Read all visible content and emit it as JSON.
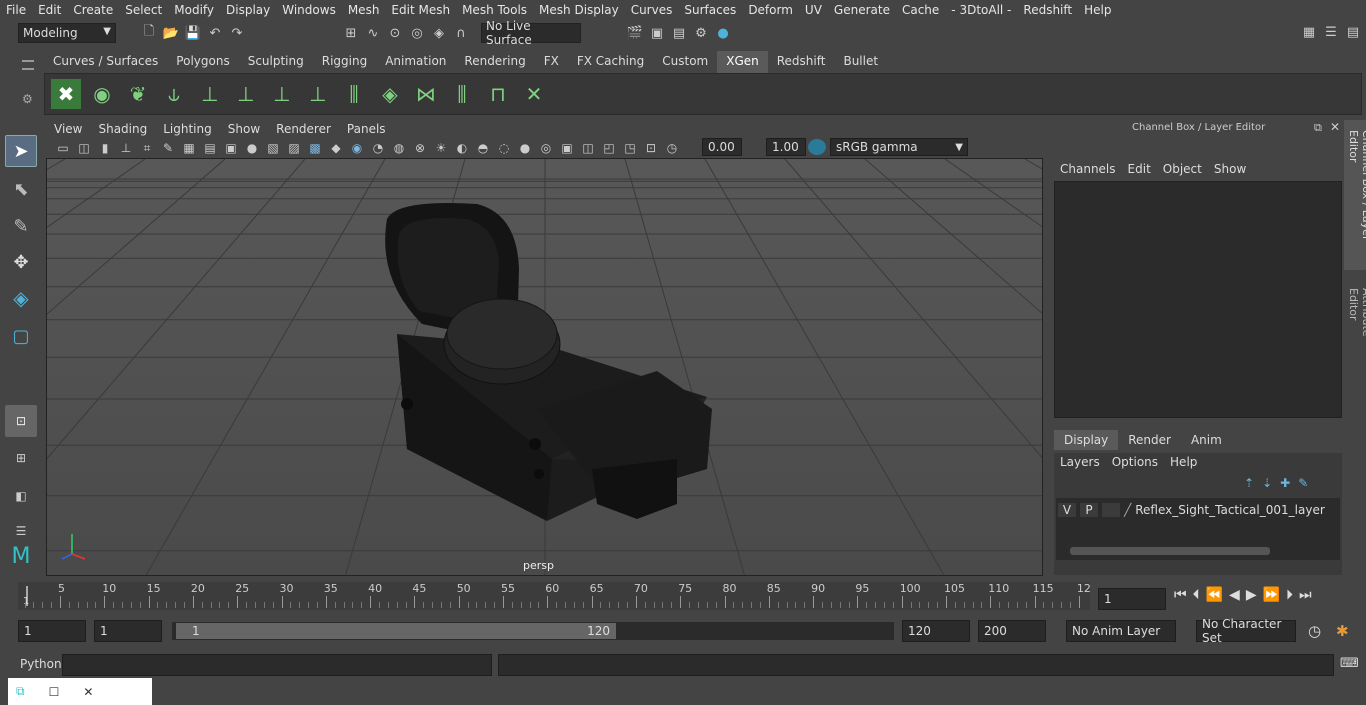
{
  "menubar": {
    "items": [
      "File",
      "Edit",
      "Create",
      "Select",
      "Modify",
      "Display",
      "Windows",
      "Mesh",
      "Edit Mesh",
      "Mesh Tools",
      "Mesh Display",
      "Curves",
      "Surfaces",
      "Deform",
      "UV",
      "Generate",
      "Cache",
      "- 3DtoAll -",
      "Redshift",
      "Help"
    ]
  },
  "status": {
    "mode": "Modeling",
    "live_surface": "No Live Surface"
  },
  "shelf": {
    "tabs": [
      "Curves / Surfaces",
      "Polygons",
      "Sculpting",
      "Rigging",
      "Animation",
      "Rendering",
      "FX",
      "FX Caching",
      "Custom",
      "XGen",
      "Redshift",
      "Bullet"
    ],
    "active_tab": "XGen"
  },
  "viewport": {
    "menu": [
      "View",
      "Shading",
      "Lighting",
      "Show",
      "Renderer",
      "Panels"
    ],
    "exposure": "0.00",
    "gamma": "1.00",
    "color_space": "sRGB gamma",
    "camera_label": "persp"
  },
  "channel_box": {
    "title": "Channel Box / Layer Editor",
    "menu": [
      "Channels",
      "Edit",
      "Object",
      "Show"
    ],
    "side_tabs": [
      "Channel Box / Layer Editor",
      "Attribute Editor"
    ],
    "layer_tabs": [
      "Display",
      "Render",
      "Anim"
    ],
    "active_layer_tab": "Display",
    "layer_menu": [
      "Layers",
      "Options",
      "Help"
    ],
    "layer": {
      "v": "V",
      "p": "P",
      "name": "Reflex_Sight_Tactical_001_layer"
    }
  },
  "timeline": {
    "ticks": [
      "5",
      "10",
      "15",
      "20",
      "25",
      "30",
      "35",
      "40",
      "45",
      "50",
      "55",
      "60",
      "65",
      "70",
      "75",
      "80",
      "85",
      "90",
      "95",
      "100",
      "105",
      "110",
      "115",
      "12"
    ],
    "start_label": "1",
    "current_frame": "1"
  },
  "range": {
    "start": "1",
    "playback_start": "1",
    "slider_start": "1",
    "slider_end": "120",
    "playback_end": "120",
    "end": "200",
    "anim_layer": "No Anim Layer",
    "character_set": "No Character Set"
  },
  "command": {
    "lang": "Python"
  }
}
